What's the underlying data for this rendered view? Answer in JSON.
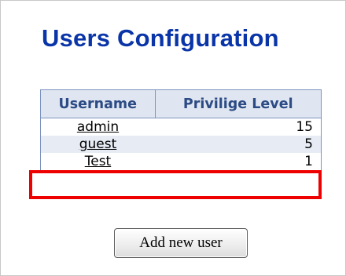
{
  "page": {
    "title": "Users Configuration"
  },
  "users_table": {
    "headers": {
      "username": "Username",
      "privilege_level": "Privilige Level"
    },
    "rows": [
      {
        "username": "admin",
        "privilege_level": "15"
      },
      {
        "username": "guest",
        "privilege_level": "5"
      },
      {
        "username": "Test",
        "privilege_level": "1"
      }
    ],
    "highlighted_row": "Test"
  },
  "actions": {
    "add_user_label": "Add new user"
  },
  "colors": {
    "title": "#0a35a8",
    "header_bg": "#dfe6f1",
    "header_text": "#2c4a84",
    "row_alt_bg": "#e6ebf4",
    "highlight": "#ee0000"
  }
}
